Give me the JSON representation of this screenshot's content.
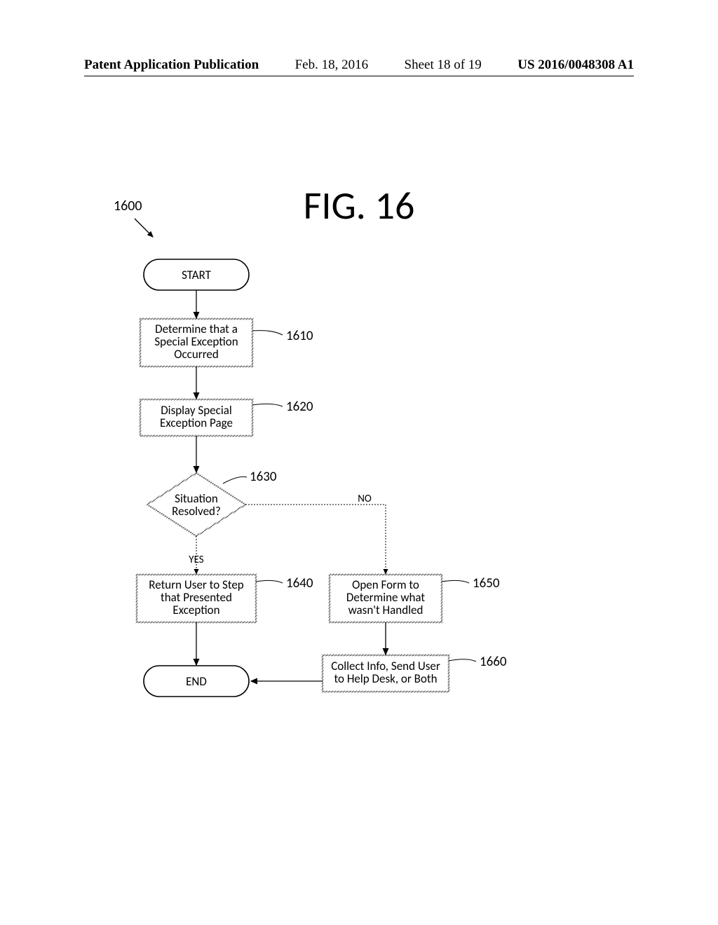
{
  "header": {
    "publication": "Patent Application Publication",
    "date": "Feb. 18, 2016",
    "sheet": "Sheet 18 of 19",
    "patent_number": "US 2016/0048308 A1"
  },
  "figure": {
    "title": "FIG. 16",
    "overall_ref": "1600"
  },
  "nodes": {
    "start": {
      "label": "START"
    },
    "n1610": {
      "line1": "Determine that a",
      "line2": "Special Exception",
      "line3": "Occurred",
      "ref": "1610"
    },
    "n1620": {
      "line1": "Display Special",
      "line2": "Exception Page",
      "ref": "1620"
    },
    "n1630": {
      "line1": "Situation",
      "line2": "Resolved?",
      "ref": "1630"
    },
    "n1640": {
      "line1": "Return User to Step",
      "line2": "that Presented",
      "line3": "Exception",
      "ref": "1640"
    },
    "n1650": {
      "line1": "Open Form to",
      "line2": "Determine what",
      "line3": "wasn't Handled",
      "ref": "1650"
    },
    "n1660": {
      "line1": "Collect Info, Send User",
      "line2": "to Help Desk, or Both",
      "ref": "1660"
    },
    "end": {
      "label": "END"
    }
  },
  "edges": {
    "yes": "YES",
    "no": "NO"
  },
  "chart_data": {
    "type": "flowchart",
    "title": "FIG. 16",
    "overall_ref": "1600",
    "nodes": [
      {
        "id": "start",
        "shape": "terminator",
        "label": "START"
      },
      {
        "id": "1610",
        "shape": "process",
        "label": "Determine that a Special Exception Occurred"
      },
      {
        "id": "1620",
        "shape": "process",
        "label": "Display Special Exception Page"
      },
      {
        "id": "1630",
        "shape": "decision",
        "label": "Situation Resolved?"
      },
      {
        "id": "1640",
        "shape": "process",
        "label": "Return User to Step that Presented Exception"
      },
      {
        "id": "1650",
        "shape": "process",
        "label": "Open Form to Determine what wasn't Handled"
      },
      {
        "id": "1660",
        "shape": "process",
        "label": "Collect Info, Send User to Help Desk, or Both"
      },
      {
        "id": "end",
        "shape": "terminator",
        "label": "END"
      }
    ],
    "edges": [
      {
        "from": "start",
        "to": "1610"
      },
      {
        "from": "1610",
        "to": "1620"
      },
      {
        "from": "1620",
        "to": "1630"
      },
      {
        "from": "1630",
        "to": "1640",
        "label": "YES"
      },
      {
        "from": "1630",
        "to": "1650",
        "label": "NO"
      },
      {
        "from": "1640",
        "to": "end"
      },
      {
        "from": "1650",
        "to": "1660"
      },
      {
        "from": "1660",
        "to": "end"
      }
    ]
  }
}
